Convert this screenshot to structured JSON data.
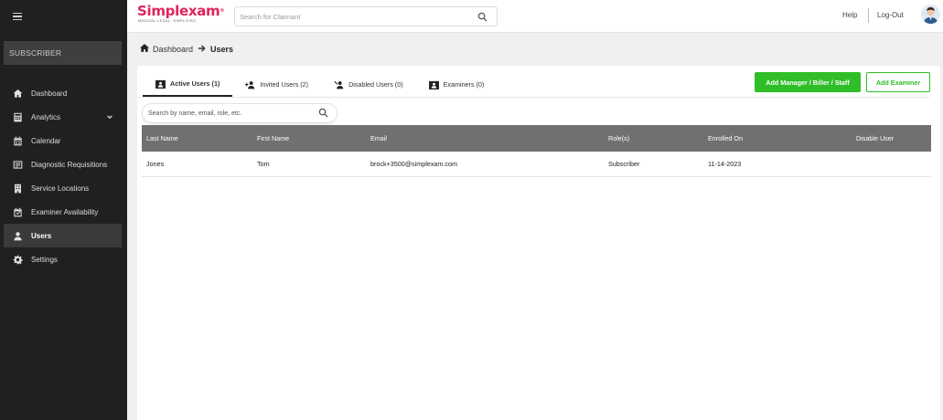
{
  "sidebar": {
    "role": "SUBSCRIBER",
    "items": [
      {
        "label": "Dashboard",
        "icon": "home-icon"
      },
      {
        "label": "Analytics",
        "icon": "calculator-icon"
      },
      {
        "label": "Calendar",
        "icon": "calendar-icon"
      },
      {
        "label": "Diagnostic Requisitions",
        "icon": "requisition-icon"
      },
      {
        "label": "Service Locations",
        "icon": "building-icon"
      },
      {
        "label": "Examiner Availability",
        "icon": "calendar-check-icon"
      },
      {
        "label": "Users",
        "icon": "users-icon"
      },
      {
        "label": "Settings",
        "icon": "gear-icon"
      }
    ],
    "active": "Users"
  },
  "topbar": {
    "logo": "Simplexam",
    "logo_tagline": "MEDICAL·LEGAL. SIMPLIFIED.",
    "search_placeholder": "Search for Claimant",
    "help": "Help",
    "logout": "Log-Out"
  },
  "breadcrumb": {
    "home": "Dashboard",
    "current": "Users"
  },
  "tabs": [
    {
      "label": "Active Users (1)",
      "icon": "id-card-icon"
    },
    {
      "label": "Invited Users (2)",
      "icon": "user-plus-icon"
    },
    {
      "label": "Disabled Users (0)",
      "icon": "user-slash-icon"
    },
    {
      "label": "Examiners (0)",
      "icon": "id-card-icon"
    }
  ],
  "buttons": {
    "add_staff": "Add Manager / Biller / Staff",
    "add_examiner": "Add Examiner"
  },
  "users_search_placeholder": "Search by name, email, role, etc.",
  "table": {
    "columns": [
      "Last Name",
      "First Name",
      "Email",
      "Role(s)",
      "Enrolled On",
      "Disable User"
    ],
    "rows": [
      [
        "Jones",
        "Tom",
        "brock+3500@simplexam.com",
        "Subscriber",
        "11-14-2023",
        ""
      ]
    ]
  },
  "colors": {
    "brand": "#e0245e",
    "accent_green": "#2fbe28",
    "sidebar_bg": "#202020",
    "table_header": "#707070"
  }
}
